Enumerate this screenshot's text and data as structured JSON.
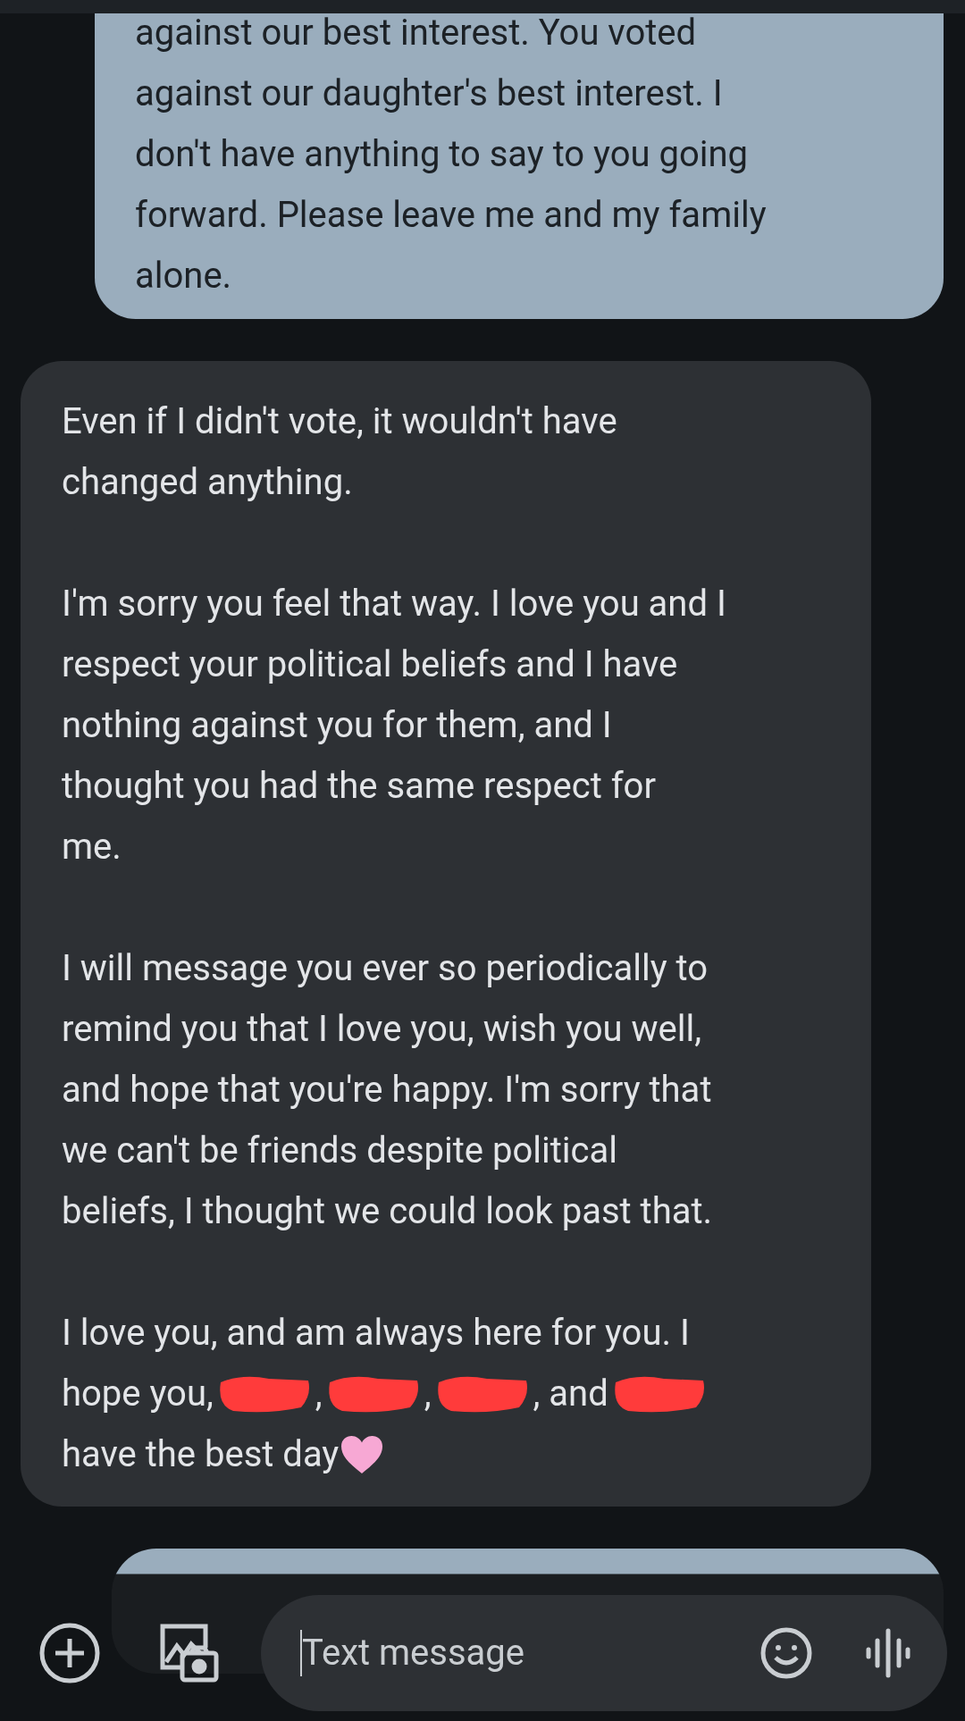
{
  "messages": [
    {
      "kind": "sent",
      "paragraphs": [
        {
          "lines": [
            "against our best interest. You voted",
            "against our daughter's best interest. I",
            "don't have anything to say to you going",
            "forward. Please leave me and my family",
            "alone."
          ]
        }
      ]
    },
    {
      "kind": "received",
      "paragraphs": [
        {
          "lines": [
            "Even if I didn't vote, it wouldn't have",
            "changed anything."
          ]
        },
        {
          "lines": [
            "I'm sorry you feel that way. I love you and I",
            "respect your political beliefs and I have",
            "nothing against you for them, and I",
            "thought you had the same respect for",
            "me."
          ]
        },
        {
          "lines": [
            "I will message you ever so periodically to",
            "remind you that I love you, wish you well,",
            "and hope that you're happy. I'm sorry that",
            "we can't be friends despite political",
            "beliefs, I thought we could look past that."
          ]
        },
        {
          "lines": [
            "I love you, and am always here for you. I"
          ],
          "segments": [
            {
              "kind": "text",
              "text": "hope you,"
            },
            {
              "kind": "redaction"
            },
            {
              "kind": "text",
              "text": ","
            },
            {
              "kind": "redaction"
            },
            {
              "kind": "text",
              "text": ","
            },
            {
              "kind": "redaction"
            },
            {
              "kind": "text",
              "text": ", and"
            },
            {
              "kind": "redaction"
            }
          ],
          "last_line": "have the best day",
          "heart": true
        }
      ]
    },
    {
      "kind": "sent_partial"
    }
  ],
  "composer": {
    "placeholder": "Text message"
  }
}
